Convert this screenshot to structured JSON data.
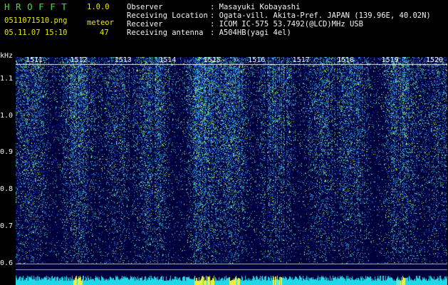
{
  "app": {
    "name": "H R O F F T",
    "version": "1.0.0"
  },
  "file": {
    "name": "0511071510.png",
    "timestamp": "05.11.07 15:10"
  },
  "counter": {
    "label": "meteor",
    "value": "47"
  },
  "station": {
    "labels": [
      "Observer",
      "Receiving Location",
      "Receiver",
      "Receiving antenna"
    ],
    "values": [
      ": Masayuki Kobayashi",
      ": Ogata-vill. Akita-Pref. JAPAN (139.96E, 40.02N)",
      ": ICOM IC-575 53.7492(@LCD)MHz USB",
      ": A504HB(yagi 4el)"
    ]
  },
  "chart_data": {
    "type": "heatmap",
    "ylabel": "kHz",
    "yticks": [
      "1.1",
      "1.0",
      "0.9",
      "0.8",
      "0.7",
      "0.6"
    ],
    "ylim": [
      0.6,
      1.15
    ],
    "xticks": [
      "1511",
      "1512",
      "1513",
      "1514",
      "1515",
      "1516",
      "1517",
      "1518",
      "1519",
      "1520"
    ],
    "colors": {
      "background": "#00003a",
      "low": "#1038c8",
      "mid": "#30b0d0",
      "high": "#80f090",
      "peak": "#e8f040",
      "axis": "#f4f4f4"
    }
  }
}
